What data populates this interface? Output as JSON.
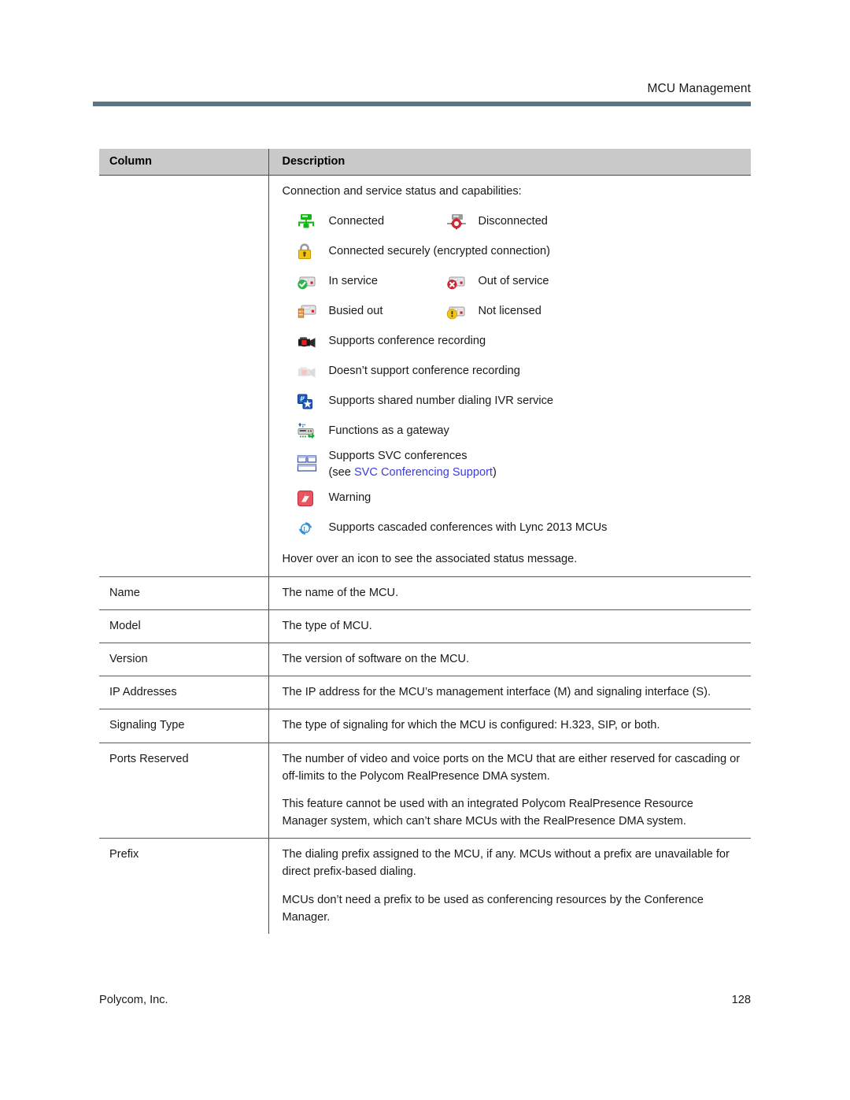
{
  "header": {
    "title": "MCU Management"
  },
  "table": {
    "headers": {
      "column": "Column",
      "description": "Description"
    },
    "status_row": {
      "label": "",
      "intro": "Connection and service status and capabilities:",
      "legend": [
        {
          "icon": "connected-icon",
          "label": "Connected"
        },
        {
          "icon": "disconnected-icon",
          "label": "Disconnected"
        },
        {
          "icon": "lock-icon",
          "label": "Connected securely (encrypted connection)"
        },
        {
          "icon": "in-service-icon",
          "label": "In service"
        },
        {
          "icon": "out-of-service-icon",
          "label": "Out of service"
        },
        {
          "icon": "busied-out-icon",
          "label": "Busied out"
        },
        {
          "icon": "not-licensed-icon",
          "label": "Not licensed"
        },
        {
          "icon": "recording-supported-icon",
          "label": "Supports conference recording"
        },
        {
          "icon": "recording-unsupported-icon",
          "label": "Doesn’t support conference recording"
        },
        {
          "icon": "ivr-icon",
          "label": "Supports shared number dialing IVR service"
        },
        {
          "icon": "gateway-icon",
          "label": "Functions as a gateway"
        },
        {
          "icon": "svc-icon",
          "label": "Supports SVC conferences",
          "sub_prefix": "(see ",
          "sub_link": "SVC Conferencing Support",
          "sub_suffix": ")"
        },
        {
          "icon": "warning-icon",
          "label": "Warning"
        },
        {
          "icon": "lync-cascade-icon",
          "label": "Supports cascaded conferences with Lync 2013 MCUs"
        }
      ],
      "note": "Hover over an icon to see the associated status message."
    },
    "rows": [
      {
        "label": "Name",
        "paragraphs": [
          "The name of the MCU."
        ]
      },
      {
        "label": "Model",
        "paragraphs": [
          "The type of MCU."
        ]
      },
      {
        "label": "Version",
        "paragraphs": [
          "The version of software on the MCU."
        ]
      },
      {
        "label": "IP Addresses",
        "paragraphs": [
          "The IP address for the MCU’s management interface (M) and signaling interface (S)."
        ]
      },
      {
        "label": "Signaling Type",
        "paragraphs": [
          "The type of signaling for which the MCU is configured: H.323, SIP, or both."
        ]
      },
      {
        "label": "Ports Reserved",
        "paragraphs": [
          "The number of video and voice ports on the MCU that are either reserved for cascading or off-limits to the Polycom RealPresence DMA system.",
          "This feature cannot be used with an integrated Polycom RealPresence Resource Manager system, which can’t share MCUs with the RealPresence DMA system."
        ]
      },
      {
        "label": "Prefix",
        "paragraphs": [
          "The dialing prefix assigned to the MCU, if any. MCUs without a prefix are unavailable for direct prefix-based dialing.",
          "MCUs don’t need a prefix to be used as conferencing resources by the Conference Manager."
        ]
      }
    ]
  },
  "footer": {
    "company": "Polycom, Inc.",
    "page_number": "128"
  },
  "colors": {
    "header_rule": "#5c7582",
    "table_header_bg": "#c9c9c9",
    "link": "#3c3cdb"
  }
}
